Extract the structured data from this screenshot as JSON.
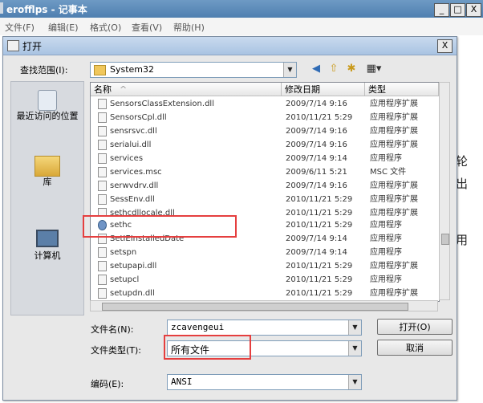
{
  "notepad": {
    "title": "erofflps - 记事本",
    "menu": [
      "文件(F)",
      "编辑(E)",
      "格式(O)",
      "查看(V)",
      "帮助(H)"
    ],
    "window_buttons": [
      "_",
      "□",
      "X"
    ],
    "right_fragments": [
      "轮",
      "出",
      "用"
    ]
  },
  "dialog": {
    "title": "打开",
    "close": "X",
    "lookin_label": "查找范围(I):",
    "lookin_value": "System32",
    "places": [
      {
        "label": "最近访问的位置"
      },
      {
        "label": "库"
      },
      {
        "label": "计算机"
      }
    ],
    "columns": [
      "名称",
      "修改日期",
      "类型"
    ],
    "files": [
      {
        "name": "SensorsClassExtension.dll",
        "date": "2009/7/14 9:16",
        "type": "应用程序扩展"
      },
      {
        "name": "SensorsCpl.dll",
        "date": "2010/11/21 5:29",
        "type": "应用程序扩展"
      },
      {
        "name": "sensrsvc.dll",
        "date": "2009/7/14 9:16",
        "type": "应用程序扩展"
      },
      {
        "name": "serialui.dll",
        "date": "2009/7/14 9:16",
        "type": "应用程序扩展"
      },
      {
        "name": "services",
        "date": "2009/7/14 9:14",
        "type": "应用程序"
      },
      {
        "name": "services.msc",
        "date": "2009/6/11 5:21",
        "type": "MSC 文件"
      },
      {
        "name": "serwvdrv.dll",
        "date": "2009/7/14 9:16",
        "type": "应用程序扩展"
      },
      {
        "name": "SessEnv.dll",
        "date": "2010/11/21 5:29",
        "type": "应用程序扩展"
      },
      {
        "name": "sethcdllocale.dll",
        "date": "2010/11/21 5:29",
        "type": "应用程序扩展"
      },
      {
        "name": "sethc",
        "date": "2010/11/21 5:29",
        "type": "应用程序"
      },
      {
        "name": "SetIEInstalledDate",
        "date": "2009/7/14 9:14",
        "type": "应用程序"
      },
      {
        "name": "setspn",
        "date": "2009/7/14 9:14",
        "type": "应用程序"
      },
      {
        "name": "setupapi.dll",
        "date": "2010/11/21 5:29",
        "type": "应用程序扩展"
      },
      {
        "name": "setupcl",
        "date": "2010/11/21 5:29",
        "type": "应用程序"
      },
      {
        "name": "setupdn.dll",
        "date": "2010/11/21 5:29",
        "type": "应用程序扩展"
      }
    ],
    "filename_label": "文件名(N):",
    "filename_value": "zcavengeui",
    "filetype_label": "文件类型(T):",
    "filetype_value": "所有文件",
    "encoding_label": "编码(E):",
    "encoding_value": "ANSI",
    "open_button": "打开(O)",
    "cancel_button": "取消"
  }
}
